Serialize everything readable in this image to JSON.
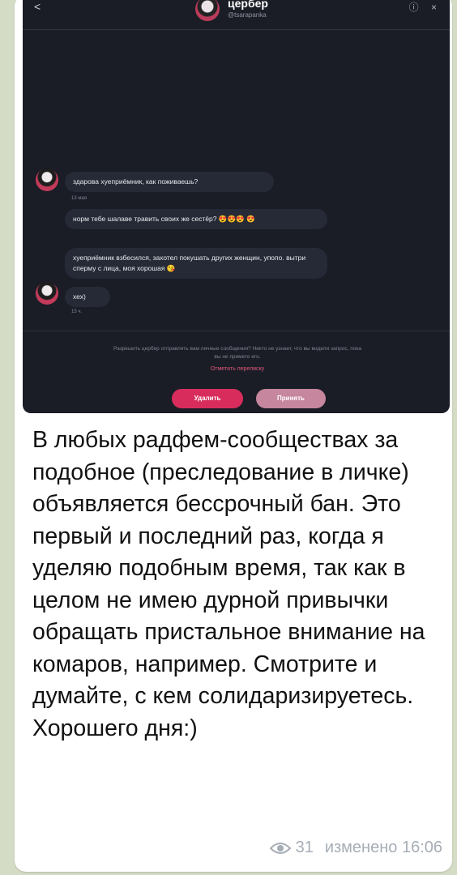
{
  "embedded_screenshot": {
    "header": {
      "back_glyph": "<",
      "name": "цербер",
      "handle": "@tsarapanka",
      "icons": "ⓘ ×"
    },
    "messages": [
      {
        "id": "m1",
        "text": "здарова хуеприёмник, как поживаешь?",
        "stamp": "13 мая"
      },
      {
        "id": "m2",
        "text": "норм тебе шалаве травить своих же сестёр? 😍😍😍 😍"
      },
      {
        "id": "m3",
        "text": "хуеприёмник взбесился, захотел покушать других женщин, упопо. вытри сперму с лица, моя хорошая 😘"
      },
      {
        "id": "m4",
        "text": "хех)",
        "stamp": "15 ч."
      }
    ],
    "notice_text": "Разрешить цербер отправлять вам личные сообщения? Никто не узнает, что вы видели запрос, пока вы не примете его.",
    "notice_link": "Отметить переписку",
    "decline_label": "Удалить",
    "accept_label": "Принять"
  },
  "caption": "В любых радфем-сообществах за подобное (преследование в личке) объявляется бессрочный бан. Это первый и последний раз, когда я уделяю подобным время, так как в целом не имею дурной привычки обращать пристальное внимание на комаров, например. Смотрите и думайте, с кем солидаризируетесь. Хорошего дня:)",
  "views": "31",
  "edited_time": "изменено 16:06"
}
